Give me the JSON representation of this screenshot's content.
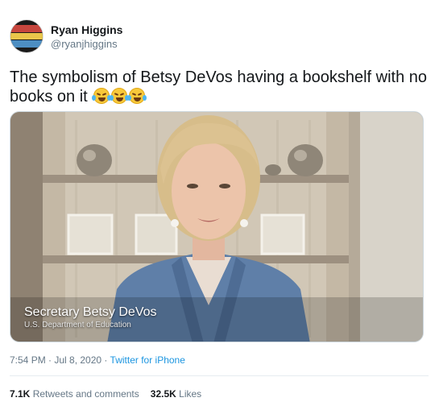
{
  "user": {
    "display_name": "Ryan Higgins",
    "handle": "@ryanjhiggins"
  },
  "tweet": {
    "text": "The symbolism of Betsy DeVos having a bookshelf with no books on it",
    "emojis": [
      "face-with-tears-of-joy",
      "face-with-tears-of-joy",
      "face-with-tears-of-joy"
    ]
  },
  "media": {
    "caption": "Secretary Betsy DeVos",
    "caption_sub": "U.S. Department of Education"
  },
  "meta": {
    "timestamp": "7:54 PM · Jul 8, 2020",
    "separator": " · ",
    "source": "Twitter for iPhone"
  },
  "stats": {
    "retweets_count": "7.1K",
    "retweets_label": "Retweets and comments",
    "likes_count": "32.5K",
    "likes_label": "Likes"
  },
  "colors": {
    "link": "#1b95e0",
    "muted": "#657786",
    "text": "#14171a"
  }
}
